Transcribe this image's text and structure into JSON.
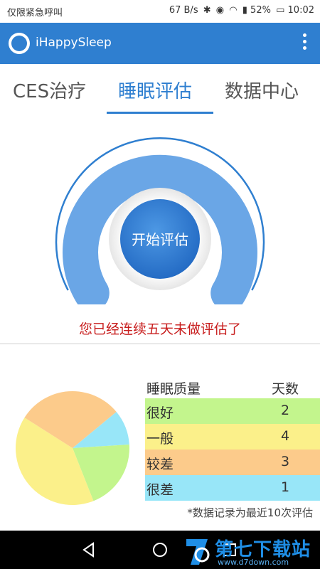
{
  "status_bar": {
    "left_text": "仅限紧急呼叫",
    "net_speed": "67 B/s",
    "battery": "52%",
    "time": "10:02"
  },
  "app_bar": {
    "title": "iHappySleep"
  },
  "tabs": [
    {
      "label": "CES治疗",
      "active": false
    },
    {
      "label": "睡眠评估",
      "active": true
    },
    {
      "label": "数据中心",
      "active": false
    }
  ],
  "gauge": {
    "button_label": "开始评估"
  },
  "notice": "您已经连续五天未做评估了",
  "quality_table": {
    "header_quality": "睡眠质量",
    "header_days": "天数",
    "rows": [
      {
        "label": "很好",
        "days": "2",
        "color": "#c3f58d"
      },
      {
        "label": "一般",
        "days": "4",
        "color": "#fbf08a"
      },
      {
        "label": "较差",
        "days": "3",
        "color": "#fccb8b"
      },
      {
        "label": "很差",
        "days": "1",
        "color": "#98e6f8"
      }
    ]
  },
  "chart_data": {
    "type": "pie",
    "categories": [
      "很好",
      "一般",
      "较差",
      "很差"
    ],
    "values": [
      2,
      4,
      3,
      1
    ],
    "colors": [
      "#c3f58d",
      "#fbf08a",
      "#fccb8b",
      "#98e6f8"
    ]
  },
  "footnote": "*数据记录为最近10次评估",
  "watermark": {
    "brand": "第七下载站",
    "url": "www.d7down.com"
  }
}
